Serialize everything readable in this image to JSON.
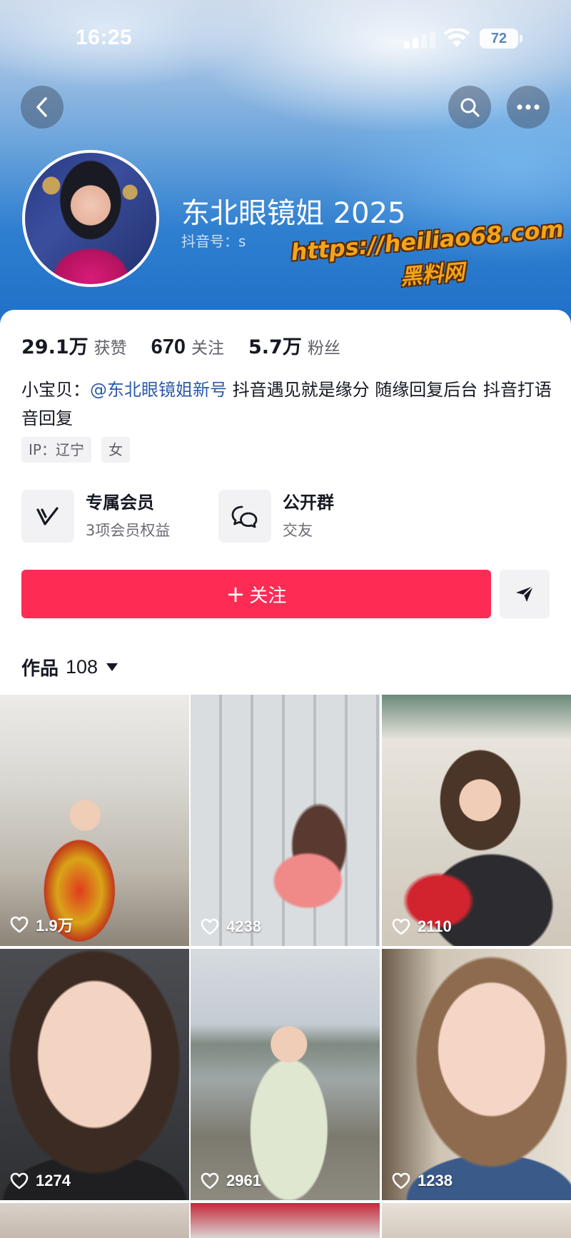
{
  "status_bar": {
    "time": "16:25",
    "battery": "72"
  },
  "header": {
    "nickname": "东北眼镜姐 2025",
    "douyin_id": "抖音号：s",
    "back_icon": "chevron-left-icon",
    "search_icon": "search-icon",
    "more_icon": "more-horizontal-icon"
  },
  "watermark": {
    "line1": "https://heiliao68.com",
    "line2": "黑料网"
  },
  "stats": [
    {
      "value": "29.1万",
      "label": "获赞"
    },
    {
      "value": "670",
      "label": "关注"
    },
    {
      "value": "5.7万",
      "label": "粉丝"
    }
  ],
  "bio": {
    "prefix": "小宝贝：",
    "mention": "@东北眼镜姐新号",
    "text": " 抖音遇见就是缘分 随缘回复后台 抖音打语音回复"
  },
  "tags": [
    "IP：辽宁",
    "女"
  ],
  "features": {
    "member": {
      "title": "专属会员",
      "subtitle": "3项会员权益",
      "icon": "member-v-icon"
    },
    "group": {
      "title": "公开群",
      "subtitle": "交友",
      "icon": "chat-bubbles-icon"
    }
  },
  "actions": {
    "follow_label": "关注",
    "follow_plus": "+",
    "share_icon": "send-icon"
  },
  "works": {
    "label": "作品",
    "count": "108"
  },
  "videos": [
    {
      "likes": "1.9万"
    },
    {
      "likes": "4238"
    },
    {
      "likes": "2110"
    },
    {
      "likes": "1274"
    },
    {
      "likes": "2961"
    },
    {
      "likes": "1238"
    }
  ],
  "colors": {
    "accent": "#fe2c55",
    "mention": "#2b5aa8",
    "text": "#161823",
    "muted": "#5f6068"
  }
}
